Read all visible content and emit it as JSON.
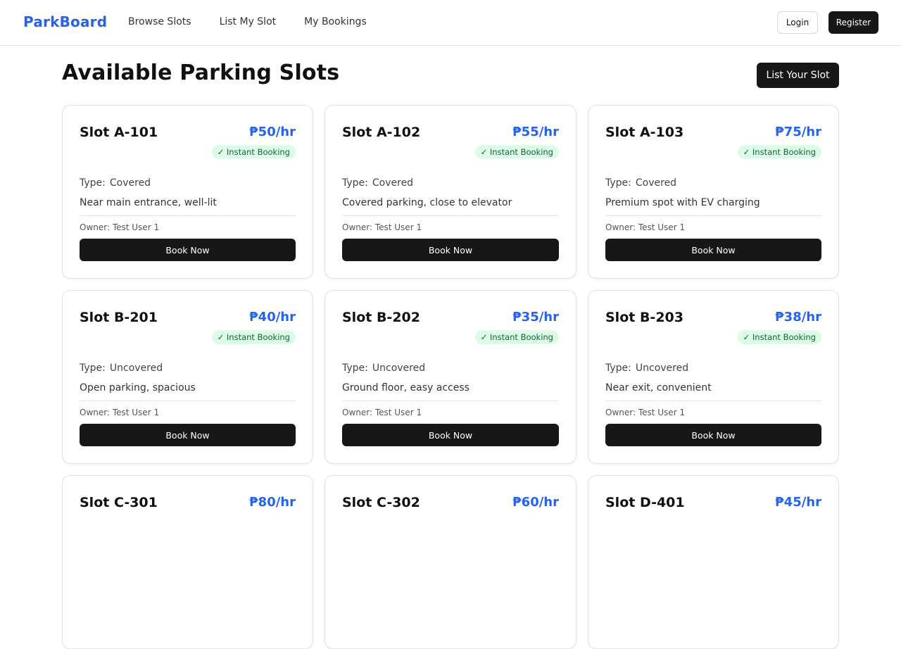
{
  "header": {
    "brand": "ParkBoard",
    "nav": [
      "Browse Slots",
      "List My Slot",
      "My Bookings"
    ],
    "login_label": "Login",
    "register_label": "Register"
  },
  "main": {
    "title": "Available Parking Slots",
    "list_button_label": "List Your Slot"
  },
  "slots": [
    {
      "name": "Slot A-101",
      "price": "₱50/hr",
      "badge": "✓ Instant Booking",
      "type_label": "Type:",
      "type": "Covered",
      "description": "Near main entrance, well-lit",
      "owner": "Owner: Test User 1",
      "button": "Book Now"
    },
    {
      "name": "Slot A-102",
      "price": "₱55/hr",
      "badge": "✓ Instant Booking",
      "type_label": "Type:",
      "type": "Covered",
      "description": "Covered parking, close to elevator",
      "owner": "Owner: Test User 1",
      "button": "Book Now"
    },
    {
      "name": "Slot A-103",
      "price": "₱75/hr",
      "badge": "✓ Instant Booking",
      "type_label": "Type:",
      "type": "Covered",
      "description": "Premium spot with EV charging",
      "owner": "Owner: Test User 1",
      "button": "Book Now"
    },
    {
      "name": "Slot B-201",
      "price": "₱40/hr",
      "badge": "✓ Instant Booking",
      "type_label": "Type:",
      "type": "Uncovered",
      "description": "Open parking, spacious",
      "owner": "Owner: Test User 1",
      "button": "Book Now"
    },
    {
      "name": "Slot B-202",
      "price": "₱35/hr",
      "badge": "✓ Instant Booking",
      "type_label": "Type:",
      "type": "Uncovered",
      "description": "Ground floor, easy access",
      "owner": "Owner: Test User 1",
      "button": "Book Now"
    },
    {
      "name": "Slot B-203",
      "price": "₱38/hr",
      "badge": "✓ Instant Booking",
      "type_label": "Type:",
      "type": "Uncovered",
      "description": "Near exit, convenient",
      "owner": "Owner: Test User 1",
      "button": "Book Now"
    },
    {
      "name": "Slot C-301",
      "price": "₱80/hr"
    },
    {
      "name": "Slot C-302",
      "price": "₱60/hr"
    },
    {
      "name": "Slot D-401",
      "price": "₱45/hr"
    }
  ],
  "colors": {
    "brand": "#2563eb",
    "price": "#2563eb",
    "primary_button": "#171717",
    "badge_bg": "#dcfce7",
    "badge_text": "#166534"
  }
}
